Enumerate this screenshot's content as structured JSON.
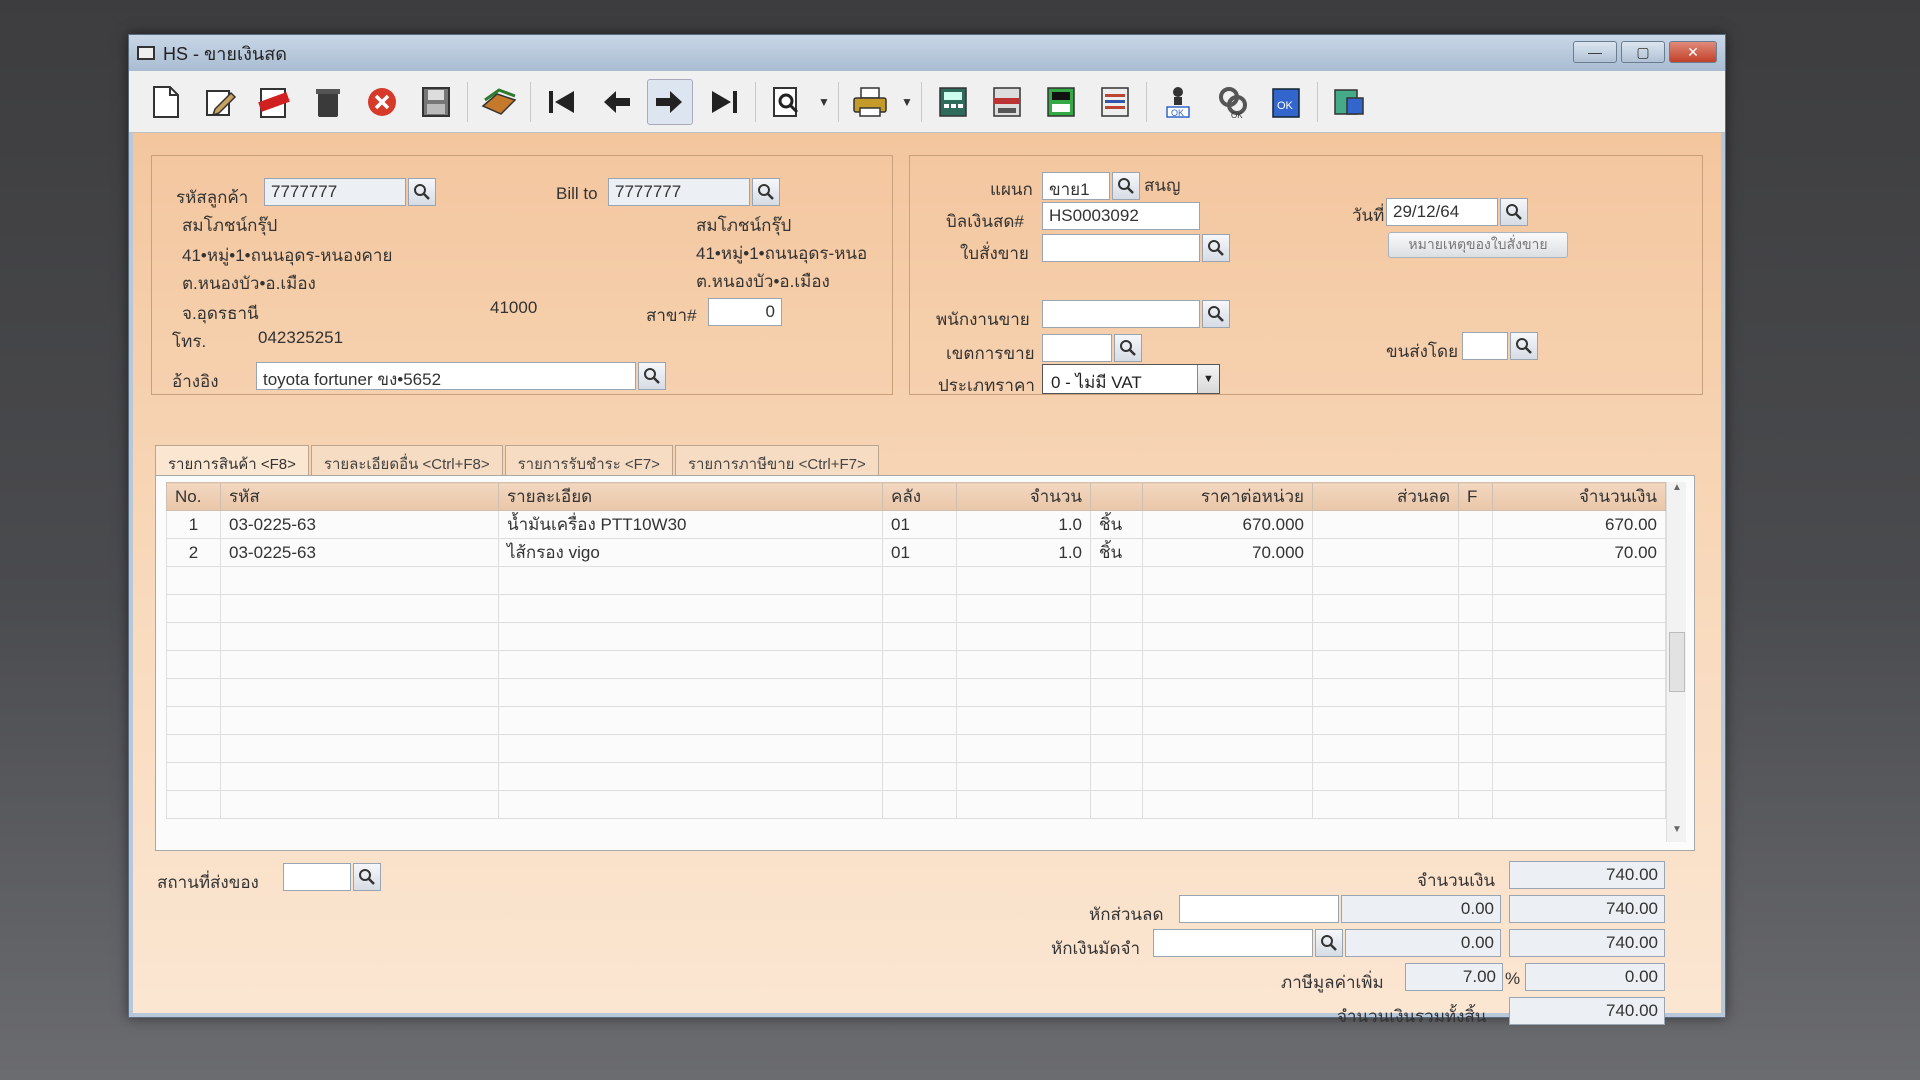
{
  "window": {
    "title": "HS - ขายเงินสด"
  },
  "toolbar": {
    "icons": [
      "new-document-icon",
      "edit-icon",
      "void-icon",
      "delete-icon",
      "cancel-icon",
      "save-icon",
      "copy-icon",
      "first-record-icon",
      "previous-record-icon",
      "next-record-icon",
      "last-record-icon",
      "search-document-icon",
      "print-icon",
      "calculator-icon",
      "register-icon",
      "report-icon",
      "list-icon",
      "approve-icon",
      "approve-all-icon",
      "confirm-icon",
      "export-icon"
    ]
  },
  "customer": {
    "code_label": "รหัสลูกค้า",
    "code": "7777777",
    "name": "สมโภชน์กรุ๊ป",
    "addr1": "41•หมู่•1•ถนนอุดร-หนองคาย",
    "addr2": "ต.หนองบัว•อ.เมือง",
    "province": "จ.อุดรธานี",
    "postcode": "41000",
    "phone_label": "โทร.",
    "phone": "042325251",
    "ref_label": "อ้างอิง",
    "ref": "toyota fortuner ขง•5652",
    "bill_to_label": "Bill to",
    "bill_to": "7777777",
    "bill_name": "สมโภชน์กรุ๊ป",
    "bill_addr1": "41•หมู่•1•ถนนอุดร-หนอ",
    "bill_addr2": "ต.หนองบัว•อ.เมือง",
    "branch_label": "สาขา#",
    "branch": "0"
  },
  "doc": {
    "dept_label": "แผนก",
    "dept": "ขาย1",
    "dept_name": "สนญ",
    "bill_no_label": "บิลเงินสด#",
    "bill_no": "HS0003092",
    "date_label": "วันที่",
    "date": "29/12/64",
    "order_label": "ใบสั่งขาย",
    "order": "",
    "note_button": "หมายเหตุของใบสั่งขาย",
    "salesman_label": "พนักงานขาย",
    "salesman": "",
    "area_label": "เขตการขาย",
    "area": "",
    "shipper_label": "ขนส่งโดย",
    "shipper": "",
    "price_type_label": "ประเภทราคา",
    "price_type": "0 - ไม่มี VAT"
  },
  "tabs": [
    "รายการสินค้า <F8>",
    "รายละเอียดอื่น <Ctrl+F8>",
    "รายการรับชำระ <F7>",
    "รายการภาษีขาย <Ctrl+F7>"
  ],
  "grid": {
    "headers": {
      "no": "No.",
      "code": "รหัส",
      "desc": "รายละเอียด",
      "wh": "คลัง",
      "qty": "จำนวน",
      "unit": "",
      "price": "ราคาต่อหน่วย",
      "disc": "ส่วนลด",
      "f": "F",
      "amount": "จำนวนเงิน"
    },
    "rows": [
      {
        "no": "1",
        "code": "03-0225-63",
        "desc": "น้ำมันเครื่อง PTT10W30",
        "wh": "01",
        "qty": "1.0",
        "unit": "ชิ้น",
        "price": "670.000",
        "disc": "",
        "f": "",
        "amount": "670.00"
      },
      {
        "no": "2",
        "code": "03-0225-63",
        "desc": "ไส้กรอง vigo",
        "wh": "01",
        "qty": "1.0",
        "unit": "ชิ้น",
        "price": "70.000",
        "disc": "",
        "f": "",
        "amount": "70.00"
      }
    ]
  },
  "footer": {
    "ship_to_label": "สถานที่ส่งของ",
    "ship_to": "",
    "subtotal_label": "จำนวนเงิน",
    "subtotal": "740.00",
    "discount_label": "หักส่วนลด",
    "discount_code": "",
    "discount_amt": "0.00",
    "after_discount": "740.00",
    "deposit_label": "หักเงินมัดจำ",
    "deposit_code": "",
    "deposit_amt": "0.00",
    "after_deposit": "740.00",
    "vat_label": "ภาษีมูลค่าเพิ่ม",
    "vat_rate": "7.00",
    "vat_unit": "%",
    "vat_amt": "0.00",
    "total_label": "จำนวนเงินรวมทั้งสิ้น",
    "total": "740.00"
  }
}
